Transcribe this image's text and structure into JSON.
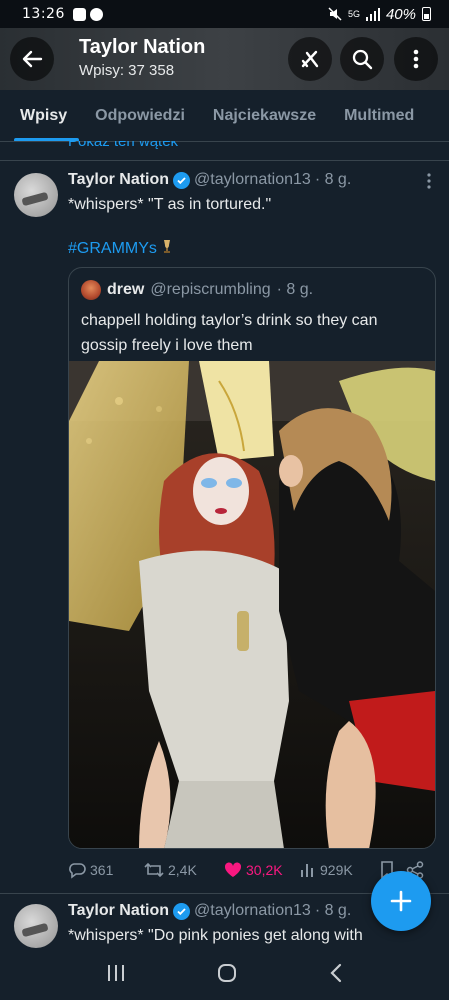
{
  "status_bar": {
    "time": "13:26",
    "network": "5G",
    "battery": "40%"
  },
  "header": {
    "title": "Taylor Nation",
    "subtitle": "Wpisy: 37 358"
  },
  "tabs": [
    {
      "label": "Wpisy",
      "active": true
    },
    {
      "label": "Odpowiedzi",
      "active": false
    },
    {
      "label": "Najciekawsze",
      "active": false
    },
    {
      "label": "Multimed",
      "active": false
    }
  ],
  "thread_link": "Pokaż ten wątek",
  "tweet1": {
    "name": "Taylor Nation",
    "handle": "@taylornation13",
    "time": "· 8 g.",
    "text": "*whispers* \"T as in tortured.\"",
    "hashtag": "#GRAMMYs",
    "quote": {
      "name": "drew",
      "handle": "@repiscrumbling",
      "time": "· 8 g.",
      "text": "chappell holding taylor’s drink so they can gossip freely i love them"
    },
    "actions": {
      "replies": "361",
      "reposts": "2,4K",
      "likes": "30,2K",
      "views": "929K"
    }
  },
  "tweet2": {
    "name": "Taylor Nation",
    "handle": "@taylornation13",
    "time": "· 8 g.",
    "text": "*whispers* \"Do pink ponies get along with"
  },
  "colors": {
    "background": "#15202b",
    "accent": "#1d9bf0",
    "like": "#f91880",
    "muted": "#8b98a5"
  }
}
